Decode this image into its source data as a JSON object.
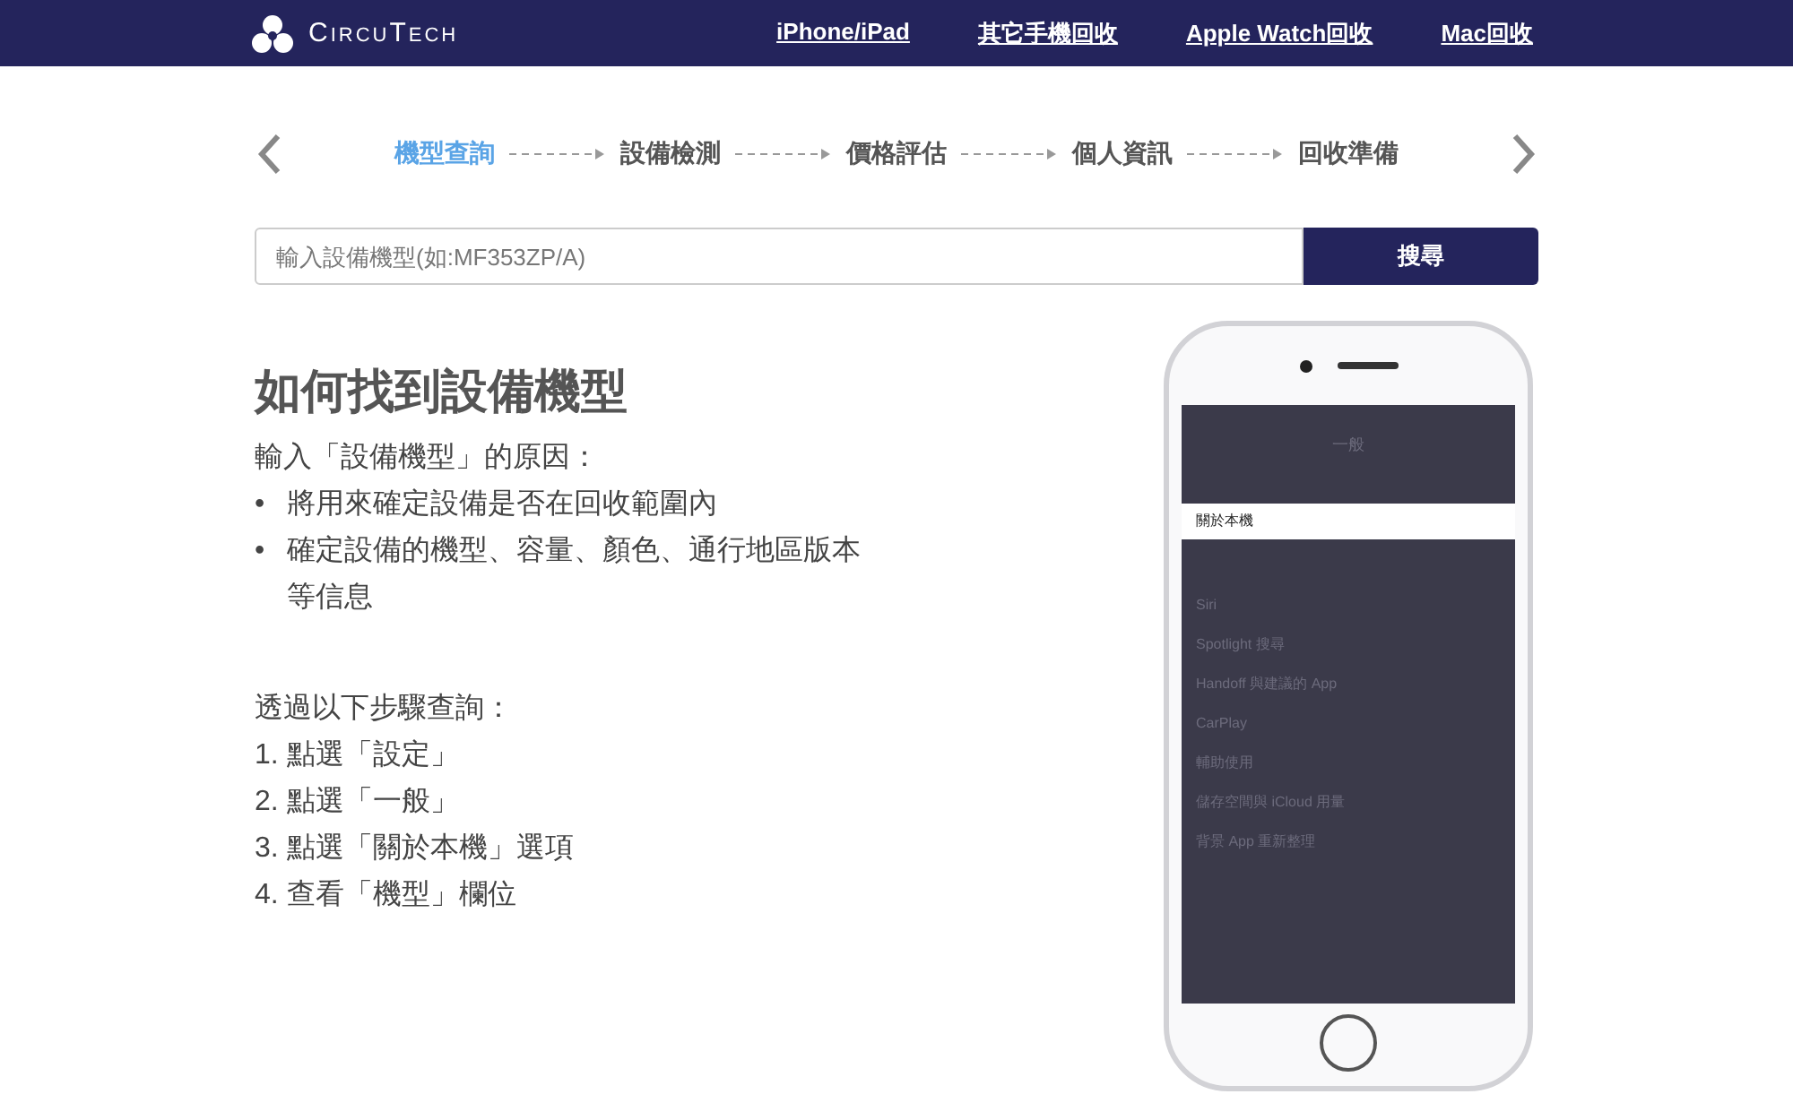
{
  "header": {
    "logo": "CircuTech",
    "nav": [
      "iPhone/iPad",
      "其它手機回收",
      "Apple Watch回收",
      "Mac回收"
    ]
  },
  "steps": [
    {
      "label": "機型查詢",
      "selected": true
    },
    {
      "label": "設備檢測",
      "selected": false
    },
    {
      "label": "價格評估",
      "selected": false
    },
    {
      "label": "個人資訊",
      "selected": false
    },
    {
      "label": "回收準備",
      "selected": false
    }
  ],
  "search": {
    "placeholder": "輸入設備機型(如:MF353ZP/A)",
    "button": "搜尋"
  },
  "guide": {
    "title": "如何找到設備機型",
    "reason_heading": "輸入「設備機型」的原因：",
    "bullet": "•",
    "reasons": [
      "將用來確定設備是否在回收範圍內",
      "確定設備的機型、容量、顏色、通行地區版本等信息"
    ],
    "steps_heading": "透過以下步驟查詢：",
    "steps": [
      "1. 點選「設定」",
      "2. 點選「一般」",
      "3. 點選「關於本機」選項",
      "4. 查看「機型」欄位"
    ]
  },
  "phone": {
    "screen_title": "一般",
    "rows": [
      {
        "label": "關於本機",
        "selected": true
      },
      {
        "label": "Siri",
        "selected": false
      },
      {
        "label": "Spotlight 搜尋",
        "selected": false
      },
      {
        "label": "Handoff 與建議的 App",
        "selected": false
      },
      {
        "label": "CarPlay",
        "selected": false
      },
      {
        "label": "輔助使用",
        "selected": false
      },
      {
        "label": "儲存空間與 iCloud 用量",
        "selected": false
      },
      {
        "label": "背景 App 重新整理",
        "selected": false
      }
    ]
  }
}
